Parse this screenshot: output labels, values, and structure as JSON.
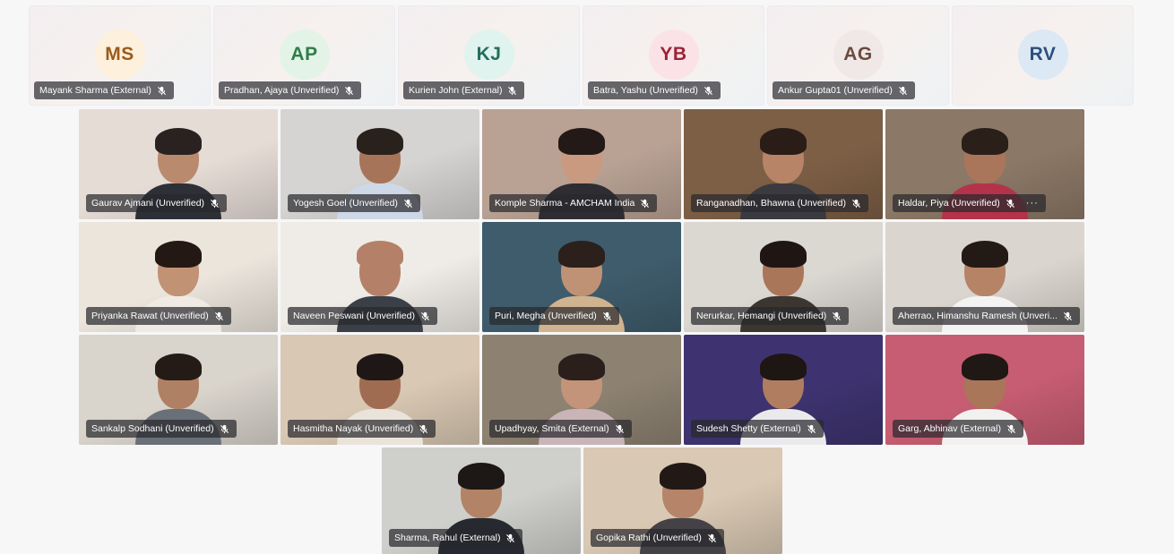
{
  "avatars": [
    {
      "initials": "MS",
      "name": "Mayank Sharma (External)",
      "bg": "#fdf0dc",
      "fg": "#9a5a1c"
    },
    {
      "initials": "AP",
      "name": "Pradhan, Ajaya (Unverified)",
      "bg": "#e3f3e6",
      "fg": "#2f7d4a"
    },
    {
      "initials": "KJ",
      "name": "Kurien John (External)",
      "bg": "#e0f3ee",
      "fg": "#226e5a"
    },
    {
      "initials": "YB",
      "name": "Batra, Yashu (Unverified)",
      "bg": "#fbe2e6",
      "fg": "#9b2336"
    },
    {
      "initials": "AG",
      "name": "Ankur Gupta01 (Unverified)",
      "bg": "#efe8e6",
      "fg": "#6b4a40"
    },
    {
      "initials": "RV",
      "name": "",
      "bg": "#dde8f5",
      "fg": "#2c4f7c"
    }
  ],
  "videos": [
    {
      "name": "Gaurav Ajmani (Unverified)",
      "bg": "#e6dcd6",
      "skin": "#b98a6d",
      "hair": "#2a2220",
      "shirt": "#2d3036",
      "more": ""
    },
    {
      "name": "Yogesh Goel (Unverified)",
      "bg": "#d6d4d2",
      "skin": "#a67559",
      "hair": "#28211c",
      "shirt": "#cfd8e6",
      "more": ""
    },
    {
      "name": "Komple Sharma - AMCHAM India",
      "bg": "#b9a294",
      "skin": "#c99a80",
      "hair": "#231917",
      "shirt": "#2d2d33",
      "more": ""
    },
    {
      "name": "Ranganadhan, Bhawna (Unverified)",
      "bg": "#7d5f45",
      "skin": "#b88467",
      "hair": "#2a1d18",
      "shirt": "#3a3a40",
      "more": ""
    },
    {
      "name": "Haldar, Piya (Unverified)",
      "bg": "#8c7866",
      "skin": "#a9765c",
      "hair": "#2b1f1a",
      "shirt": "#b4334a",
      "more": "···"
    },
    {
      "name": "Priyanka Rawat (Unverified)",
      "bg": "#ebe5dc",
      "skin": "#c29274",
      "hair": "#231814",
      "shirt": "#efeae4",
      "more": ""
    },
    {
      "name": "Naveen Peswani (Unverified)",
      "bg": "#efece7",
      "skin": "#b48168",
      "hair": "#b48168",
      "shirt": "#3b4048",
      "more": ""
    },
    {
      "name": "Puri, Megha (Unverified)",
      "bg": "#3f5c6c",
      "skin": "#c09275",
      "hair": "#2b201b",
      "shirt": "#d0b38f",
      "more": ""
    },
    {
      "name": "Nerurkar, Hemangi (Unverified)",
      "bg": "#dbd7d1",
      "skin": "#a97659",
      "hair": "#1f1614",
      "shirt": "#3b3630",
      "more": ""
    },
    {
      "name": "Aherrao, Himanshu Ramesh (Unveri...",
      "bg": "#dad5ce",
      "skin": "#b68366",
      "hair": "#231a16",
      "shirt": "#f3f3f3",
      "more": ""
    },
    {
      "name": "Sankalp Sodhani (Unverified)",
      "bg": "#d9d4cc",
      "skin": "#b08064",
      "hair": "#241b17",
      "shirt": "#6a7078",
      "more": ""
    },
    {
      "name": "Hasmitha Nayak (Unverified)",
      "bg": "#d9c8b3",
      "skin": "#9f6c52",
      "hair": "#1f1715",
      "shirt": "#e9e3da",
      "more": ""
    },
    {
      "name": "Upadhyay, Smita (External)",
      "bg": "#8d8272",
      "skin": "#c39479",
      "hair": "#2b1f1c",
      "shirt": "#c9b5b8",
      "more": ""
    },
    {
      "name": "Sudesh Shetty (External)",
      "bg": "#3e3370",
      "skin": "#b07d61",
      "hair": "#1d1613",
      "shirt": "#eaeaec",
      "more": ""
    },
    {
      "name": "Garg, Abhinav (External)",
      "bg": "#c75d72",
      "skin": "#a9765a",
      "hair": "#201815",
      "shirt": "#f3f1f0",
      "more": ""
    },
    {
      "name": "Sharma, Rahul (External)",
      "bg": "#cfcfcc",
      "skin": "#b28366",
      "hair": "#1d1715",
      "shirt": "#262a30",
      "more": ""
    },
    {
      "name": "Gopika Rathi (Unverified)",
      "bg": "#d9c8b3",
      "skin": "#b58469",
      "hair": "#221917",
      "shirt": "#444247",
      "more": ""
    }
  ]
}
